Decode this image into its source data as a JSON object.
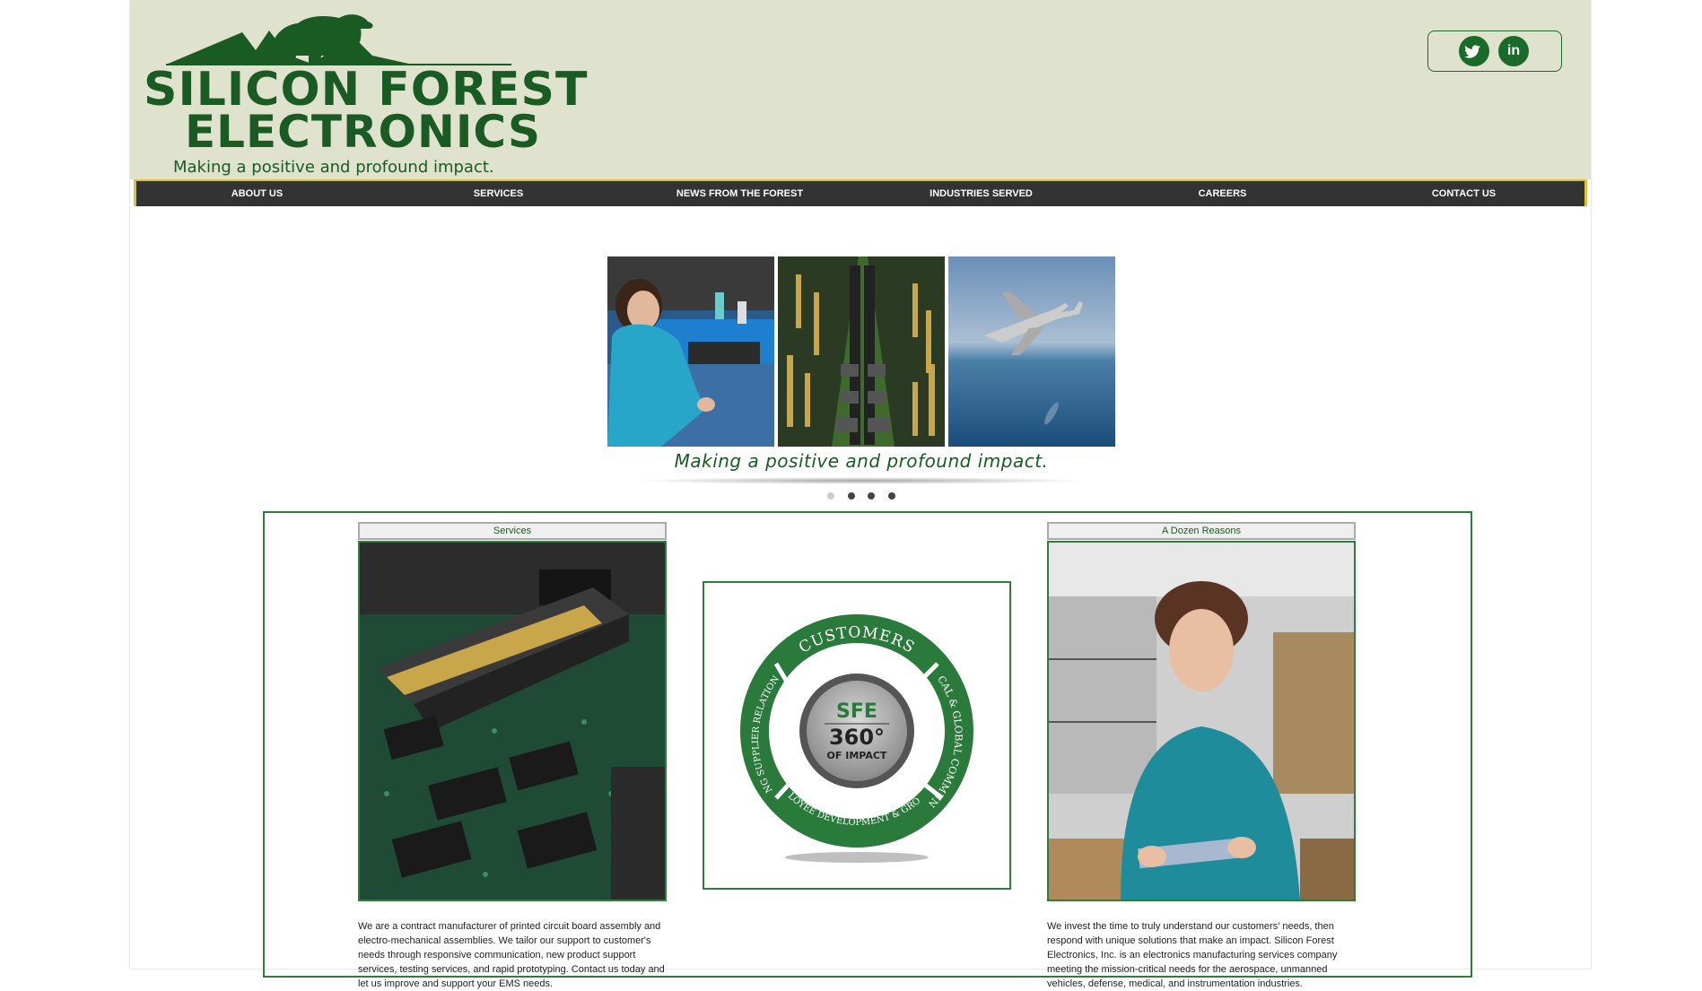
{
  "header": {
    "logo_line1": "SILICON FOREST",
    "logo_line2": "ELECTRONICS",
    "tagline": "Making a positive and profound impact.",
    "social": [
      {
        "icon": "twitter-icon",
        "glyph": "🐦"
      },
      {
        "icon": "linkedin-icon",
        "glyph": "in"
      }
    ]
  },
  "nav": {
    "items": [
      "ABOUT US",
      "SERVICES",
      "NEWS FROM THE FOREST",
      "INDUSTRIES SERVED",
      "CAREERS",
      "CONTACT US"
    ]
  },
  "slider": {
    "caption": "Making a positive and profound impact.",
    "dots": 4,
    "active_dot": 0
  },
  "services": {
    "title": "Services",
    "text": "We are a contract manufacturer of printed circuit board assembly and electro-mechanical assemblies. We tailor our support to customer's needs through responsive communication, new product support services, testing services, and rapid prototyping. Contact us today and let us improve and support your EMS needs."
  },
  "impact_graphic": {
    "center_line1": "SFE",
    "center_line2": "360°",
    "center_line3": "OF IMPACT",
    "arc_top": "CUSTOMERS",
    "arc_right": "LOCAL & GLOBAL COMMUNITY",
    "arc_bottom": "EMPLOYEE DEVELOPMENT & GROWTH",
    "arc_left": "STRONG SUPPLIER RELATIONSHIPS"
  },
  "reasons": {
    "title": "A Dozen Reasons",
    "text": "We invest the time to truly understand our customers' needs, then respond with unique solutions that make an impact. Silicon Forest Electronics, Inc. is an electronics manufacturing services company meeting the mission-critical needs for the aerospace, unmanned vehicles, defense, medical, and instrumentation industries."
  },
  "colors": {
    "brand_green": "#1a5a23",
    "header_bg": "#dfe2cd",
    "nav_bg": "#333333",
    "nav_accent": "#d9c23a"
  }
}
